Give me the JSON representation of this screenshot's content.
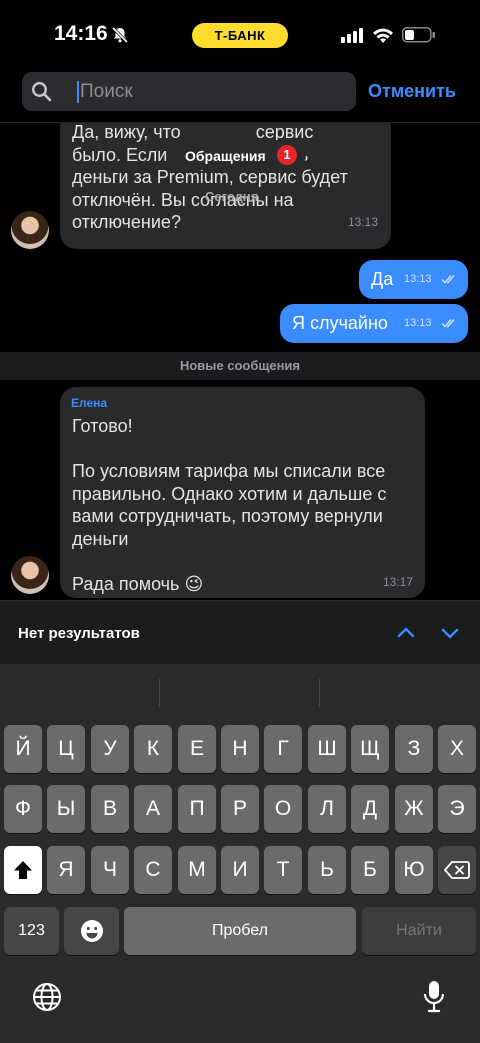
{
  "status": {
    "time": "14:16",
    "carrier_label": "Т-БАНК"
  },
  "search": {
    "placeholder": "Поиск",
    "cancel_label": "Отменить"
  },
  "chat": {
    "top_message": {
      "text": "Да, вижу, что               сервис\nбыло. Если               вернуть\nденьги за Premium, сервис будет\nотключён. Вы согласны на\nотключение?",
      "time": "13:13"
    },
    "appeals_pill": {
      "label": "Обращения",
      "count": "1"
    },
    "date_label": "Сегодня",
    "outgoing": [
      {
        "text": "Да",
        "time": "13:13"
      },
      {
        "text": "Я случайно",
        "time": "13:13"
      }
    ],
    "new_messages_label": "Новые сообщения",
    "incoming": {
      "sender": "Елена",
      "text": "Готово!\n\nПо условиям тарифа мы списали все\nправильно. Однако хотим и дальше с\nвами сотрудничать, поэтому вернули\nденьги\n\nРада помочь 😉",
      "time": "13:17"
    }
  },
  "results": {
    "label": "Нет результатов"
  },
  "keyboard": {
    "row1": [
      "Й",
      "Ц",
      "У",
      "К",
      "Е",
      "Н",
      "Г",
      "Ш",
      "Щ",
      "З",
      "Х"
    ],
    "row2": [
      "Ф",
      "Ы",
      "В",
      "А",
      "П",
      "Р",
      "О",
      "Л",
      "Д",
      "Ж",
      "Э"
    ],
    "row3": [
      "Я",
      "Ч",
      "С",
      "М",
      "И",
      "Т",
      "Ь",
      "Б",
      "Ю"
    ],
    "numbers_label": "123",
    "space_label": "Пробел",
    "go_label": "Найти"
  },
  "colors": {
    "accent": "#3a8cff",
    "bank_yellow": "#ffdd2d",
    "badge_red": "#e3262b"
  }
}
